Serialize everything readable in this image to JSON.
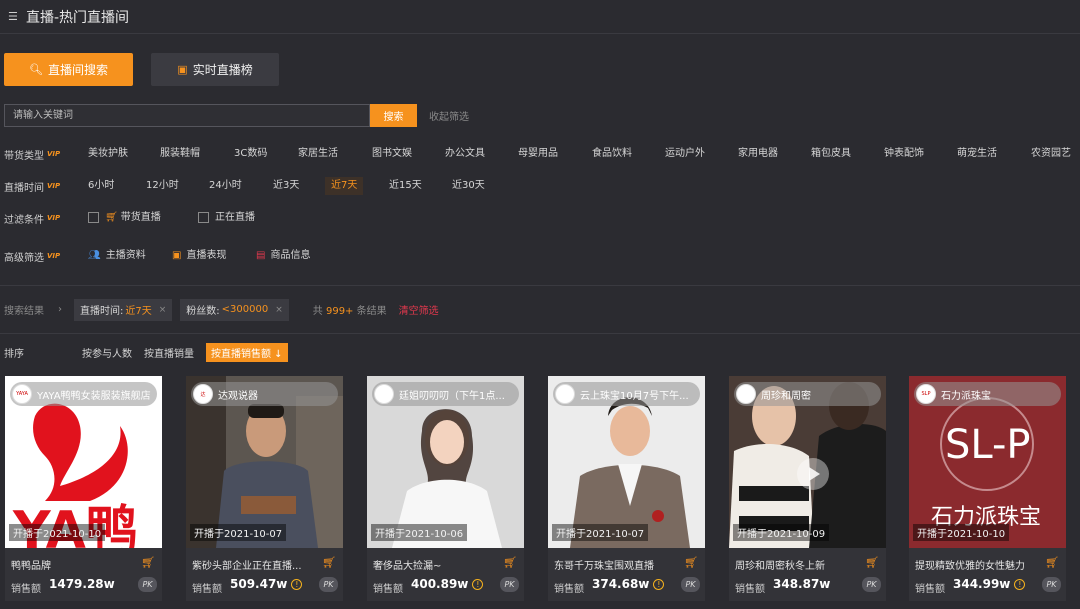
{
  "header": {
    "title": "直播-热门直播间"
  },
  "tabs": [
    {
      "label": "直播间搜索"
    },
    {
      "label": "实时直播榜"
    }
  ],
  "search": {
    "placeholder": "请输入关键词",
    "button": "搜索",
    "collapse": "收起筛选"
  },
  "vip": "VIP",
  "filters": {
    "category": {
      "label": "带货类型",
      "options": [
        "美妆护肤",
        "服装鞋帽",
        "3C数码",
        "家居生活",
        "图书文娱",
        "办公文具",
        "母婴用品",
        "食品饮料",
        "运动户外",
        "家用电器",
        "箱包皮具",
        "钟表配饰",
        "萌宠生活",
        "农资园艺"
      ]
    },
    "time": {
      "label": "直播时间",
      "options": [
        "6小时",
        "12小时",
        "24小时",
        "近3天",
        "近7天",
        "近15天",
        "近30天"
      ],
      "selected": "近7天"
    },
    "conditions": {
      "label": "过滤条件",
      "options": [
        "带货直播",
        "正在直播"
      ]
    },
    "advanced": {
      "label": "高级筛选",
      "options": [
        "主播资料",
        "直播表现",
        "商品信息"
      ]
    }
  },
  "results": {
    "label": "搜索结果",
    "chips": [
      {
        "key": "直播时间:",
        "value": "近7天"
      },
      {
        "key": "粉丝数:",
        "value": "<300000"
      }
    ],
    "count_prefix": "共",
    "count": "999+",
    "count_suffix": "条结果",
    "clear": "清空筛选"
  },
  "sort": {
    "label": "排序",
    "options": [
      "按参与人数",
      "按直播销量",
      "按直播销售额"
    ],
    "active": "按直播销售额"
  },
  "cards": [
    {
      "anchor": "YAYA鸭鸭女装服装旗舰店",
      "avatar_text": "YAYA",
      "date": "开播于2021-10-10",
      "title": "鸭鸭品牌",
      "sales_label": "销售额",
      "sales": "1479.28w",
      "warn": false,
      "thumb_color": "#ffffff"
    },
    {
      "anchor": "达观说器",
      "avatar_text": "达",
      "date": "开播于2021-10-07",
      "title": "紫砂头部企业正在直播...",
      "sales_label": "销售额",
      "sales": "509.47w",
      "warn": true,
      "thumb_color": "#5c5650"
    },
    {
      "anchor": "廷姐叨叨叨（下午1点...",
      "avatar_text": "",
      "date": "开播于2021-10-06",
      "title": "奢侈品大捡漏~",
      "sales_label": "销售额",
      "sales": "400.89w",
      "warn": true,
      "thumb_color": "#dcdcdc"
    },
    {
      "anchor": "云上珠宝10月7号下午...",
      "avatar_text": "",
      "date": "开播于2021-10-07",
      "title": "东哥千万珠宝围观直播",
      "sales_label": "销售额",
      "sales": "374.68w",
      "warn": true,
      "thumb_color": "#e9e9e9"
    },
    {
      "anchor": "周珍和周密",
      "avatar_text": "",
      "date": "开播于2021-10-09",
      "title": "周珍和周密秋冬上新",
      "sales_label": "销售额",
      "sales": "348.87w",
      "warn": false,
      "thumb_color": "#3b2f2f"
    },
    {
      "anchor": "石力派珠宝",
      "avatar_text": "SLP",
      "date": "开播于2021-10-10",
      "title": "提现精致优雅的女性魅力",
      "sales_label": "销售额",
      "sales": "344.99w",
      "warn": true,
      "thumb_color": "#8b2a2e"
    }
  ],
  "pk_label": "PK",
  "colors": {
    "accent": "#f6921e",
    "background": "#2b2b30",
    "danger": "#e2384d"
  }
}
